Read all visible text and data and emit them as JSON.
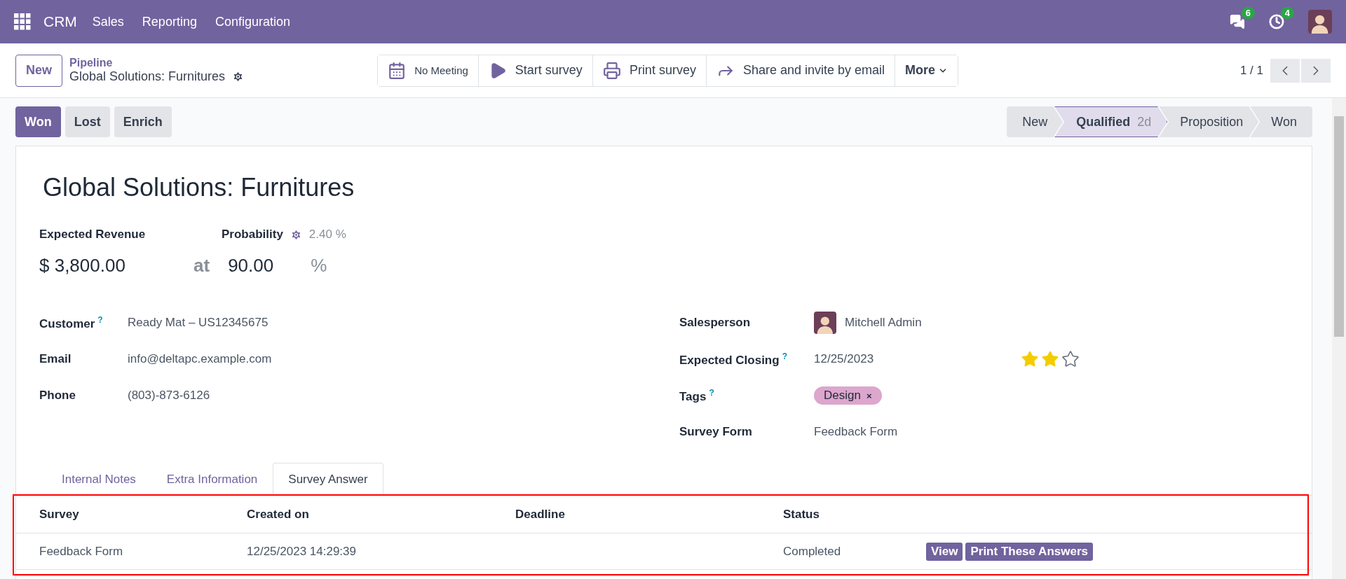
{
  "navbar": {
    "app": "CRM",
    "menu": [
      "Sales",
      "Reporting",
      "Configuration"
    ],
    "messages_count": "6",
    "activities_count": "4"
  },
  "control_panel": {
    "new_button": "New",
    "breadcrumb": "Pipeline",
    "record": "Global Solutions: Furnitures",
    "actions": [
      {
        "kind": "calendar",
        "label": "No Meeting"
      },
      {
        "kind": "play",
        "label": "Start survey"
      },
      {
        "kind": "print",
        "label": "Print survey"
      },
      {
        "kind": "share",
        "label": "Share and invite by email"
      }
    ],
    "more": "More",
    "pager": "1 / 1"
  },
  "status_buttons": [
    {
      "label": "Won",
      "kind": "primary"
    },
    {
      "label": "Lost",
      "kind": "secondary"
    },
    {
      "label": "Enrich",
      "kind": "secondary"
    }
  ],
  "stages": [
    {
      "label": "New",
      "selected": false
    },
    {
      "label": "Qualified",
      "duration": "2d",
      "selected": true
    },
    {
      "label": "Proposition",
      "selected": false
    },
    {
      "label": "Won",
      "selected": false
    }
  ],
  "form": {
    "title": "Global Solutions: Furnitures",
    "revenue_label": "Expected Revenue",
    "probability_label": "Probability",
    "automated_probability": "2.40 %",
    "revenue": "$ 3,800.00",
    "at": "at",
    "probability": "90.00",
    "percent": "%",
    "left_fields": [
      {
        "label": "Customer",
        "help": "?",
        "value": "Ready Mat – US12345675"
      },
      {
        "label": "Email",
        "value": "info@deltapc.example.com"
      },
      {
        "label": "Phone",
        "value": "(803)-873-6126"
      }
    ],
    "right_fields": [
      {
        "kind": "user",
        "label": "Salesperson",
        "value": "Mitchell Admin"
      },
      {
        "kind": "date",
        "label": "Expected Closing",
        "help": "?",
        "value": "12/25/2023",
        "stars": 2
      },
      {
        "kind": "tags",
        "label": "Tags",
        "help": "?",
        "value": "Design",
        "remove": "×",
        "color": "#dca6cd"
      },
      {
        "kind": "text",
        "label": "Survey Form",
        "value": "Feedback Form"
      }
    ]
  },
  "tabs": [
    {
      "label": "Internal Notes",
      "selected": false
    },
    {
      "label": "Extra Information",
      "selected": false
    },
    {
      "label": "Survey Answer",
      "selected": true
    }
  ],
  "table": {
    "columns": [
      "Survey",
      "Created on",
      "Deadline",
      "Status"
    ],
    "rows": [
      {
        "cells": [
          "Feedback Form",
          "12/25/2023 14:29:39",
          "",
          "Completed"
        ],
        "buttons": [
          "View",
          "Print These Answers"
        ]
      }
    ]
  }
}
